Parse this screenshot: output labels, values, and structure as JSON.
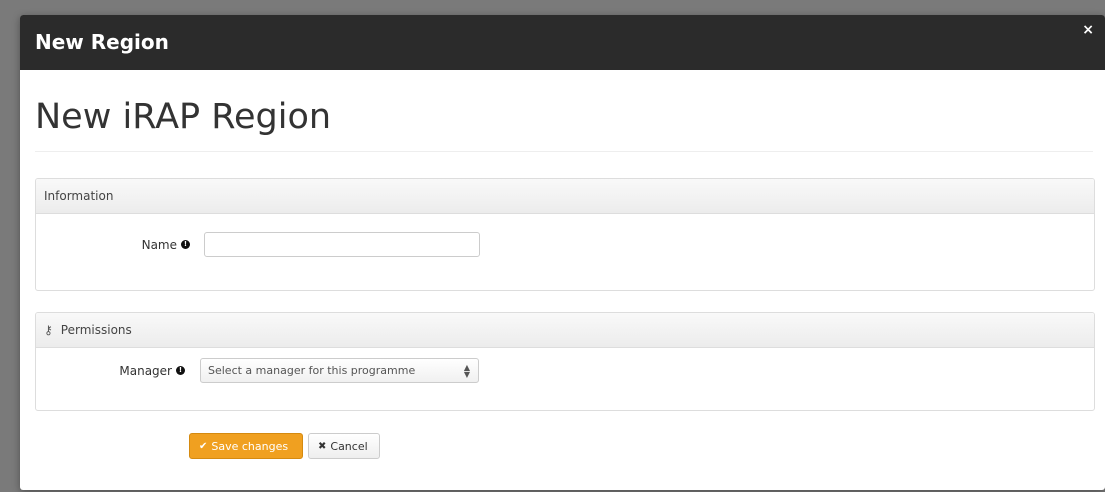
{
  "modal": {
    "title": "New Region",
    "close_label": "×"
  },
  "page": {
    "heading": "New iRAP Region"
  },
  "information_panel": {
    "title": "Information",
    "name_label": "Name",
    "name_value": "",
    "name_placeholder": ""
  },
  "permissions_panel": {
    "title": "Permissions",
    "icon": "key-icon",
    "manager_label": "Manager",
    "manager_selected": "Select a manager for this programme"
  },
  "actions": {
    "save_label": "Save changes",
    "cancel_label": "Cancel"
  },
  "colors": {
    "header_bg": "#2b2b2b",
    "save_bg": "#f0a020"
  }
}
